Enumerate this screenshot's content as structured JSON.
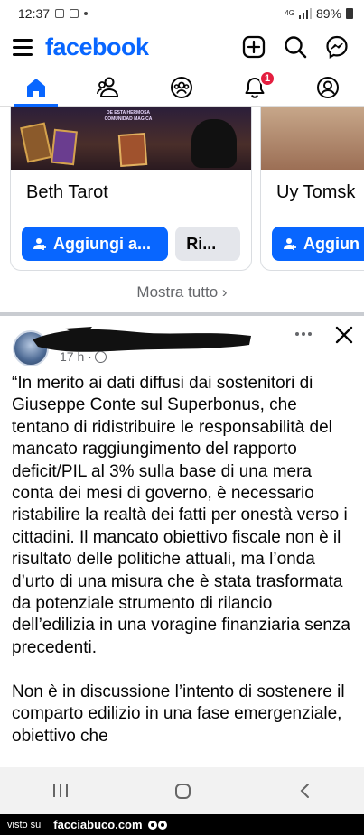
{
  "status_bar": {
    "time": "12:37",
    "network": "4G",
    "battery": "89%"
  },
  "app_bar": {
    "logo": "facebook",
    "icons": [
      "menu-icon",
      "add-icon",
      "search-icon",
      "messenger-icon"
    ]
  },
  "tabs": [
    {
      "name": "home",
      "active": true
    },
    {
      "name": "friends",
      "active": false
    },
    {
      "name": "groups",
      "active": false
    },
    {
      "name": "notifications",
      "active": false,
      "badge": "1"
    },
    {
      "name": "profile",
      "active": false
    }
  ],
  "suggestions": {
    "cards": [
      {
        "image_caption": "DE ESTA HERMOSA COMUNIDAD MÁGICA",
        "name": "Beth Tarot",
        "primary_button": "Aggiungi a...",
        "secondary_button": "Ri..."
      },
      {
        "name": "Uy Tomsk",
        "primary_button": "Aggiun"
      }
    ],
    "see_all": "Mostra tutto"
  },
  "post": {
    "time": "17 h ·",
    "text": "“In merito ai dati diffusi dai sostenitori di Giuseppe Conte sul Superbonus, che tentano di ridistribuire le responsabilità del mancato raggiungimento del rapporto deficit/PIL al 3% sulla base di una mera conta dei mesi di governo, è necessario ristabilire la realtà dei fatti per onestà verso i cittadini. Il mancato obiettivo fiscale non è il risultato delle politiche attuali, ma l’onda d’urto di una misura che è stata trasformata da potenziale strumento di rilancio dell’edilizia in una voragine finanziaria senza precedenti.\n\nNon è in discussione l’intento di sostenere il comparto edilizio in una fase emergenziale, obiettivo che"
  },
  "watermark": {
    "prefix": "visto su",
    "site": "facciabuco.com"
  },
  "colors": {
    "brand": "#0866ff",
    "badge": "#e41e3f",
    "secondary_button": "#e4e6eb",
    "muted_text": "#65676b"
  }
}
